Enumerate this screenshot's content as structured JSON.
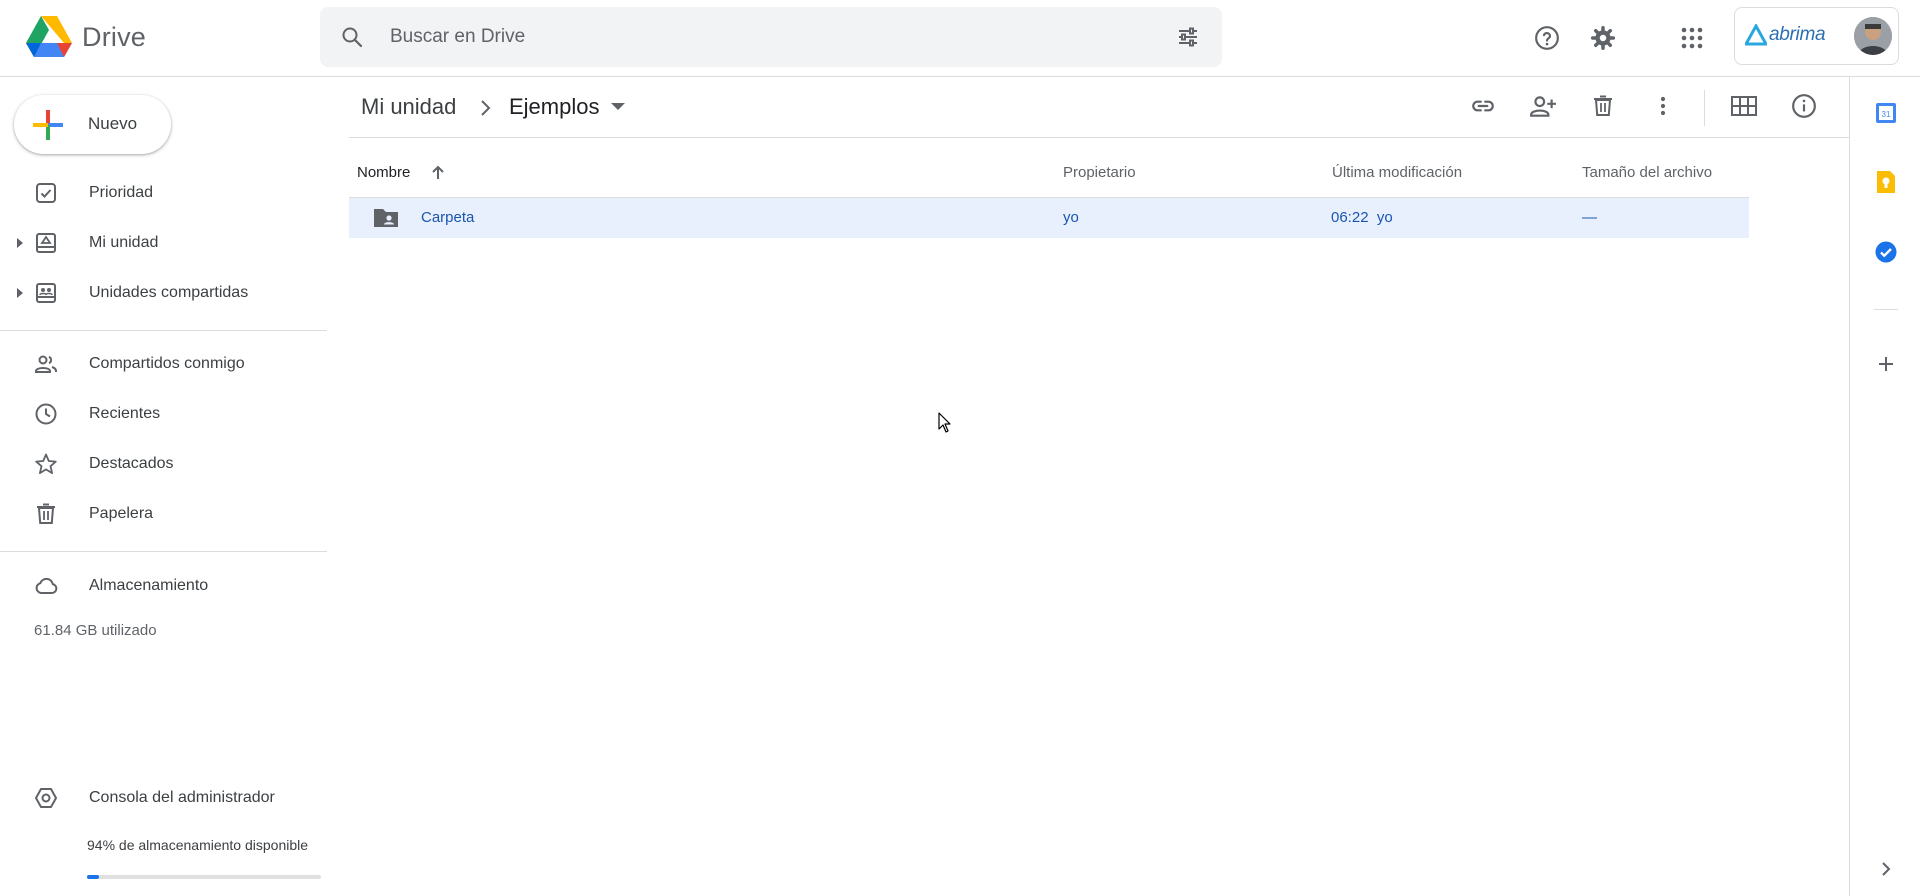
{
  "app": {
    "name": "Drive"
  },
  "search": {
    "placeholder": "Buscar en Drive"
  },
  "account": {
    "org_logo_text": "abrima"
  },
  "new_button": {
    "label": "Nuevo"
  },
  "sidebar": {
    "items": [
      {
        "label": "Prioridad",
        "icon": "priority-check-icon"
      },
      {
        "label": "Mi unidad",
        "icon": "my-drive-icon"
      },
      {
        "label": "Unidades compartidas",
        "icon": "shared-drives-icon"
      },
      {
        "label": "Compartidos conmigo",
        "icon": "people-icon"
      },
      {
        "label": "Recientes",
        "icon": "clock-icon"
      },
      {
        "label": "Destacados",
        "icon": "star-icon"
      },
      {
        "label": "Papelera",
        "icon": "trash-icon"
      },
      {
        "label": "Almacenamiento",
        "icon": "cloud-icon"
      }
    ],
    "storage_used": "61.84 GB utilizado",
    "admin_console": "Consola del administrador",
    "storage_available": "94% de almacenamiento disponible",
    "storage_bar_fill_fraction": 0.05
  },
  "breadcrumb": {
    "root": "Mi unidad",
    "current": "Ejemplos"
  },
  "table": {
    "columns": {
      "name": "Nombre",
      "owner": "Propietario",
      "modified": "Última modificación",
      "size": "Tamaño del archivo"
    },
    "rows": [
      {
        "name": "Carpeta",
        "owner": "yo",
        "modified": "06:22  yo",
        "size": "—"
      }
    ]
  },
  "colors": {
    "accent": "#1a73e8",
    "selected_row": "#e8f0fe"
  }
}
